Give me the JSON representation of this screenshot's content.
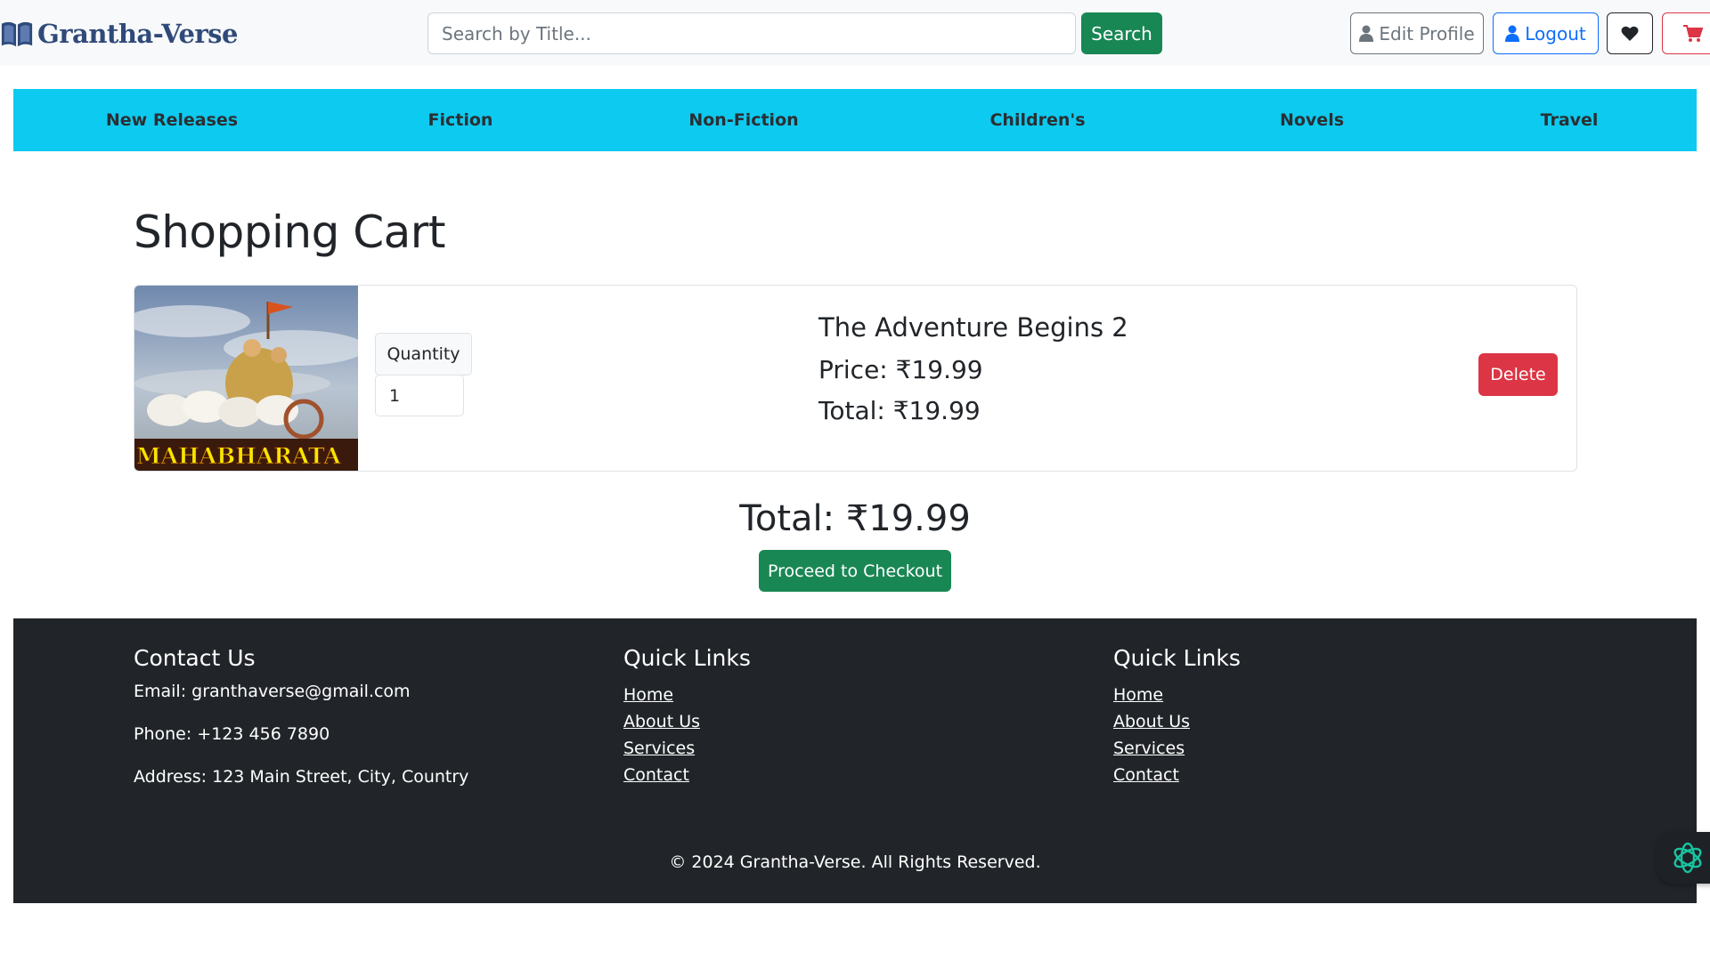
{
  "brand": {
    "name": "Grantha-Verse"
  },
  "search": {
    "placeholder": "Search by Title...",
    "button_label": "Search"
  },
  "header": {
    "edit_profile_label": "Edit Profile",
    "logout_label": "Logout"
  },
  "categories": [
    "New Releases",
    "Fiction",
    "Non-Fiction",
    "Children's",
    "Novels",
    "Travel"
  ],
  "cart": {
    "title": "Shopping Cart",
    "item": {
      "cover_text": "MAHABHARATA",
      "quantity_label": "Quantity",
      "quantity_value": "1",
      "title": "The Adventure Begins 2",
      "price": "Price: ₹19.99",
      "total": "Total: ₹19.99",
      "delete_label": "Delete"
    },
    "grand_total": "Total: ₹19.99",
    "checkout_label": "Proceed to Checkout"
  },
  "footer": {
    "contact": {
      "heading": "Contact Us",
      "email": "Email: granthaverse@gmail.com",
      "phone": "Phone: +123 456 7890",
      "address": "Address: 123 Main Street, City, Country"
    },
    "quick_links_1": {
      "heading": "Quick Links",
      "links": [
        "Home",
        "About Us",
        "Services",
        "Contact"
      ]
    },
    "quick_links_2": {
      "heading": "Quick Links",
      "links": [
        "Home",
        "About Us",
        "Services",
        "Contact"
      ]
    },
    "copyright": "© 2024 Grantha-Verse. All Rights Reserved."
  },
  "colors": {
    "nav_bg": "#0dcaf0",
    "success": "#198754",
    "danger": "#dc3545",
    "primary": "#0d6efd",
    "footer_bg": "#212529"
  }
}
